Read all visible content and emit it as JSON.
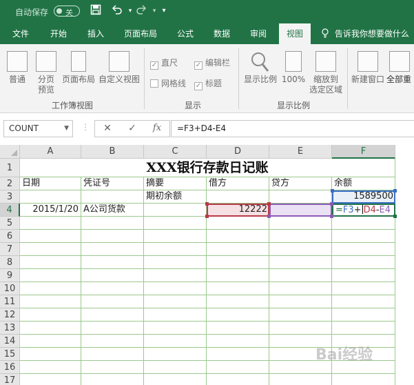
{
  "titlebar": {
    "autosave_label": "自动保存",
    "autosave_state": "关",
    "icons": [
      "save-icon",
      "undo-icon",
      "redo-icon",
      "customize-icon"
    ]
  },
  "tabs": [
    {
      "label": "文件"
    },
    {
      "label": "开始"
    },
    {
      "label": "插入"
    },
    {
      "label": "页面布局"
    },
    {
      "label": "公式"
    },
    {
      "label": "数据"
    },
    {
      "label": "审阅"
    },
    {
      "label": "视图",
      "active": true
    }
  ],
  "tell_me": "告诉我你想要做什么",
  "ribbon": {
    "workbook_views": {
      "label": "工作簿视图",
      "normal": "普通",
      "page_break_1": "分页",
      "page_break_2": "预览",
      "page_layout": "页面布局",
      "custom_views": "自定义视图"
    },
    "show": {
      "label": "显示",
      "ruler": "直尺",
      "formula_bar": "编辑栏",
      "gridlines": "网格线",
      "headings": "标题"
    },
    "zoom": {
      "label": "显示比例",
      "zoom": "显示比例",
      "zoom_100": "100%",
      "zoom_sel_1": "缩放到",
      "zoom_sel_2": "选定区域"
    },
    "window": {
      "new_window": "新建窗口",
      "arrange_all": "全部重"
    }
  },
  "formula_bar": {
    "name_box": "COUNT",
    "formula": "=F3+D4-E4"
  },
  "columns": [
    "A",
    "B",
    "C",
    "D",
    "E",
    "F"
  ],
  "rows": [
    "1",
    "2",
    "3",
    "4",
    "5",
    "6",
    "7",
    "8",
    "9",
    "10",
    "11",
    "12",
    "13",
    "14",
    "15",
    "16",
    "17"
  ],
  "sheet": {
    "title": "XXX银行存款日记账",
    "headers": [
      "日期",
      "凭证号",
      "摘要",
      "借方",
      "贷方",
      "余额"
    ],
    "row3_summary": "期初余额",
    "row3_balance": "1589500",
    "row4_date": "2015/1/20",
    "row4_voucher": "A公司货款",
    "row4_debit": "12222",
    "editing_formula": {
      "eq": "=",
      "f3": "F3",
      "plus": "+",
      "d4": "D4",
      "minus": "-",
      "e4": "E4"
    }
  },
  "watermark": "Bai经验"
}
